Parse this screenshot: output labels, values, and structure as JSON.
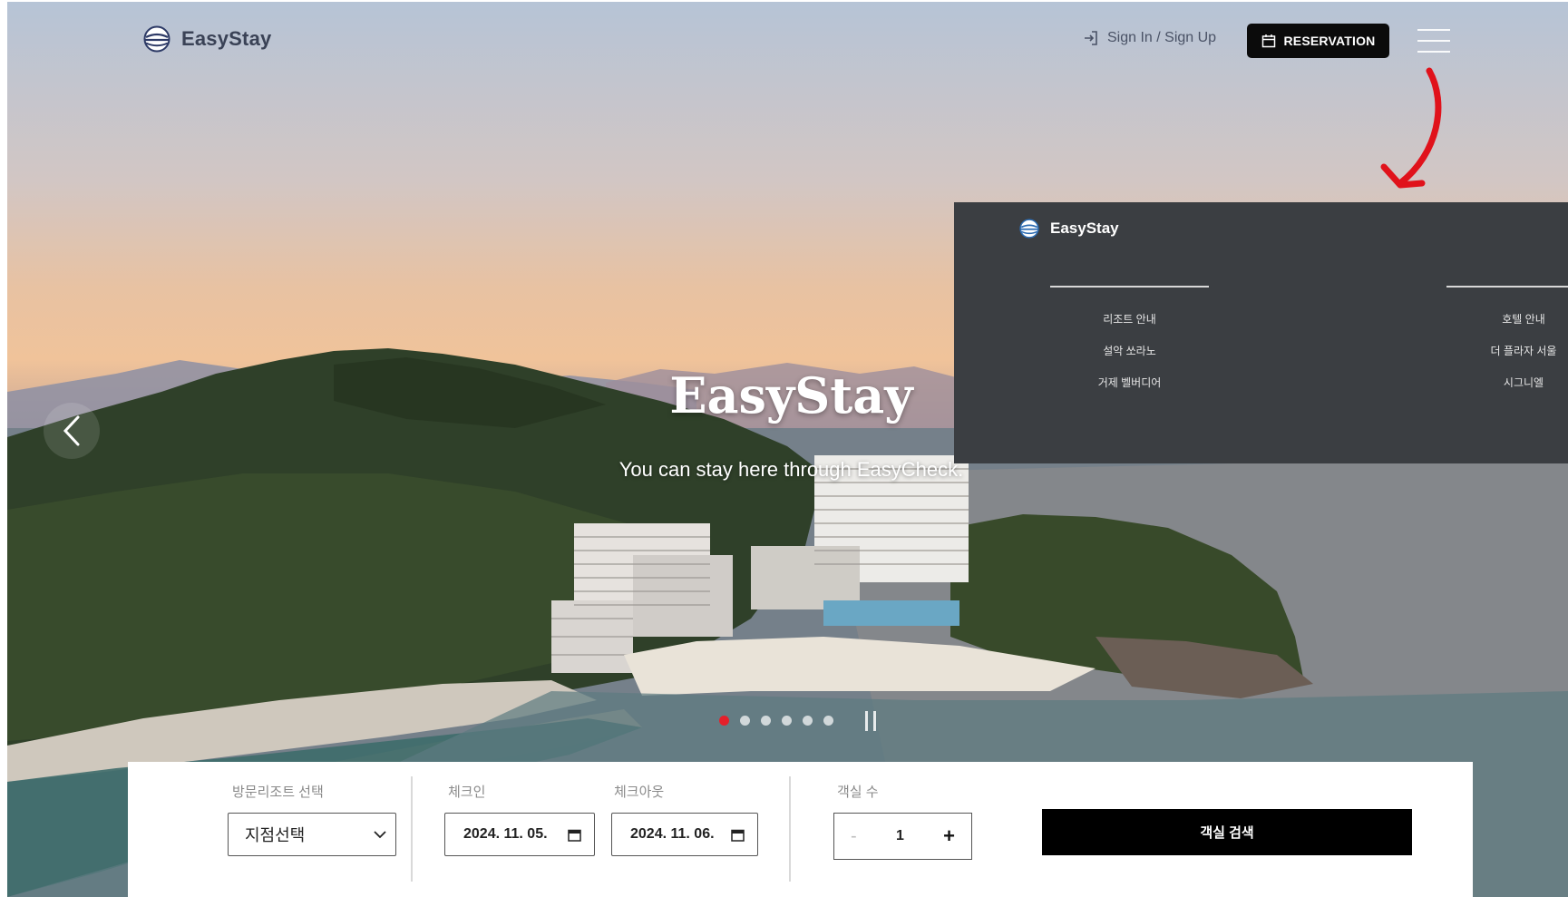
{
  "header": {
    "brand": "EasyStay",
    "signin_label": "Sign In / Sign Up",
    "reservation_label": "RESERVATION"
  },
  "menu_panel": {
    "brand": "EasyStay",
    "columns": [
      {
        "items": [
          "리조트 안내",
          "설악 쏘라노",
          "거제 벨버디어"
        ]
      },
      {
        "items": [
          "호텔 안내",
          "더 플라자 서울",
          "시그니엘"
        ]
      }
    ]
  },
  "hero": {
    "title": "EasyStay",
    "subtitle": "You can stay here through EasyCheck.",
    "slides": {
      "count": 6,
      "active_index": 0
    }
  },
  "booking": {
    "resort_label": "방문리조트 선택",
    "resort_value": "지점선택",
    "checkin_label": "체크인",
    "checkin_value": "2024. 11. 05.",
    "checkout_label": "체크아웃",
    "checkout_value": "2024. 11. 06.",
    "rooms_label": "객실 수",
    "rooms_minus": "-",
    "rooms_value": "1",
    "rooms_plus": "+",
    "search_label": "객실 검색"
  },
  "colors": {
    "accent_red": "#e5202a",
    "panel_bg": "#3b3e42",
    "button_black": "#0b0b0b",
    "annotation_arrow": "#e0121b"
  },
  "icons": {
    "logo": "globe-logo-icon",
    "signin": "login-arrow-icon",
    "reservation": "calendar-icon",
    "menu": "hamburger-icon",
    "prev": "chevron-left-icon",
    "pause": "pause-icon",
    "select": "chevron-down-icon",
    "date": "calendar-icon"
  }
}
